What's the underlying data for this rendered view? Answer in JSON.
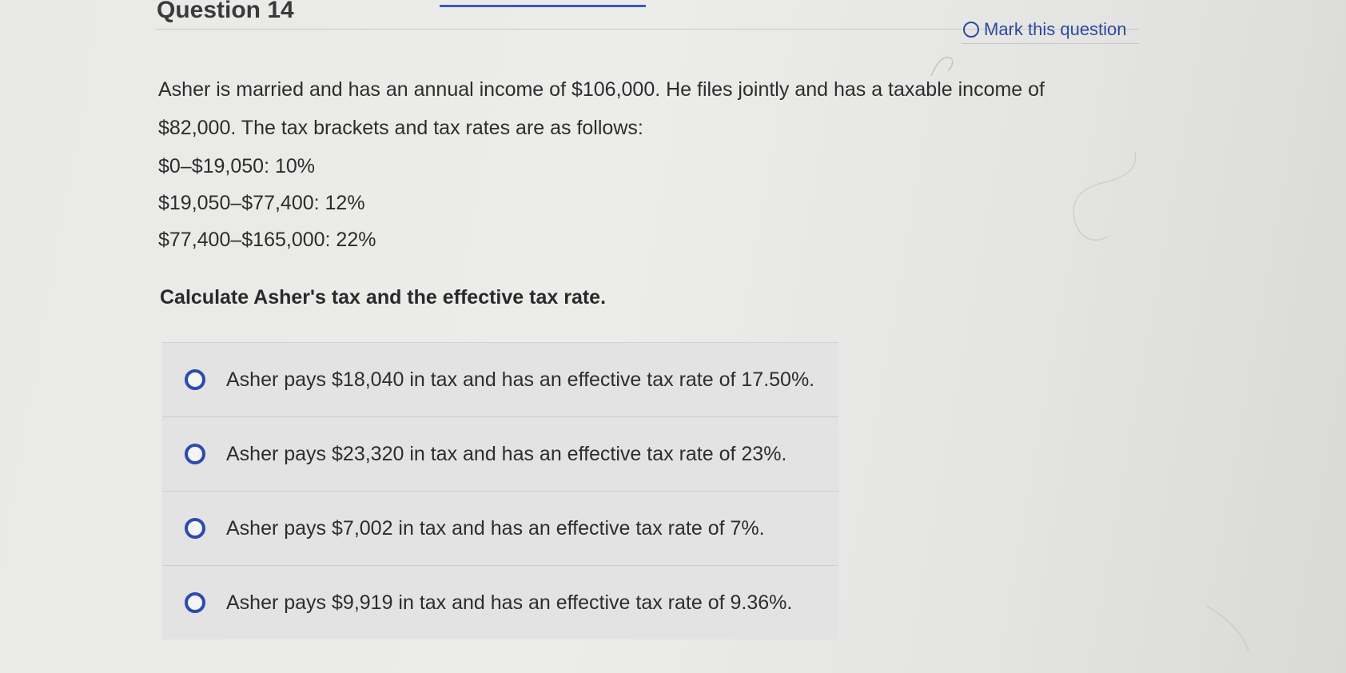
{
  "header": {
    "question_title": "Question 14",
    "mark_label": "Mark this question"
  },
  "stem": {
    "line1": "Asher is married and has an annual income of $106,000. He files jointly and has a taxable income of",
    "line2": "$82,000. The tax brackets and tax rates are as follows:",
    "brackets": [
      "$0–$19,050: 10%",
      "$19,050–$77,400: 12%",
      "$77,400–$165,000: 22%"
    ]
  },
  "prompt": "Calculate Asher's tax and the effective tax rate.",
  "options": [
    "Asher pays $18,040 in tax and has an effective tax rate of 17.50%.",
    "Asher pays $23,320 in tax and has an effective tax rate of 23%.",
    "Asher pays $7,002 in tax and has an effective tax rate of 7%.",
    "Asher pays $9,919 in tax and has an effective tax rate of 9.36%."
  ],
  "colors": {
    "accent": "#2a4bb0",
    "background": "#e9e9e7"
  }
}
